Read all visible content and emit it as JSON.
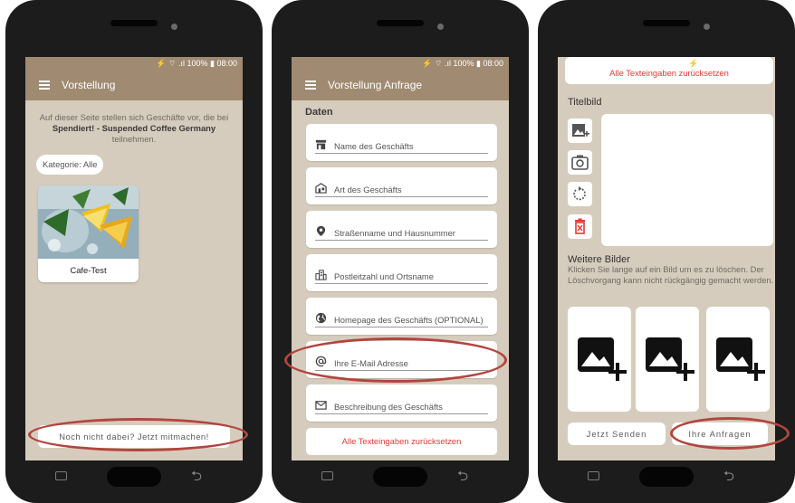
{
  "status_bar": {
    "text": "⚡ ⌔ .ıl 100% ▮ 08:00"
  },
  "screen1": {
    "title": "Vorstellung",
    "intro_prefix": "Auf dieser Seite stellen sich Geschäfte vor, die bei",
    "intro_bold": "Spendiert! - Suspended Coffee Germany",
    "intro_suffix": "teilnehmen.",
    "category_chip": "Kategorie: Alle",
    "shop_card_name": "Cafe-Test",
    "join_button": "Noch nicht dabei? Jetzt mitmachen!"
  },
  "screen2": {
    "title": "Vorstellung Anfrage",
    "section_label": "Daten",
    "fields": [
      {
        "label": "Name des Geschäfts",
        "icon": "store-icon"
      },
      {
        "label": "Art des Geschäfts",
        "icon": "shop-type-icon"
      },
      {
        "label": "Straßenname und Hausnummer",
        "icon": "location-pin-icon"
      },
      {
        "label": "Postleitzahl und Ortsname",
        "icon": "city-icon"
      },
      {
        "label": "Homepage des Geschäfts (OPTIONAL)",
        "icon": "globe-icon"
      },
      {
        "label": "Ihre E-Mail Adresse",
        "icon": "at-sign-icon"
      },
      {
        "label": "Beschreibung des Geschäfts",
        "icon": "envelope-icon"
      }
    ],
    "reset_button": "Alle Texteingaben zurücksetzen"
  },
  "screen3": {
    "reset_button": "Alle Texteingaben zurücksetzen",
    "cover_label": "Titelbild",
    "more_images_label": "Weitere Bilder",
    "more_images_hint": "Klicken Sie lange auf ein Bild um es zu löschen. Der Löschvorgang kann nicht rückgängig gemacht werden.",
    "send_button": "Jetzt Senden",
    "requests_button": "Ihre Anfragen"
  },
  "colors": {
    "appbar": "#a08a72",
    "background": "#d6ccbd",
    "danger": "#e53935",
    "highlight_oval": "#b3453f"
  }
}
